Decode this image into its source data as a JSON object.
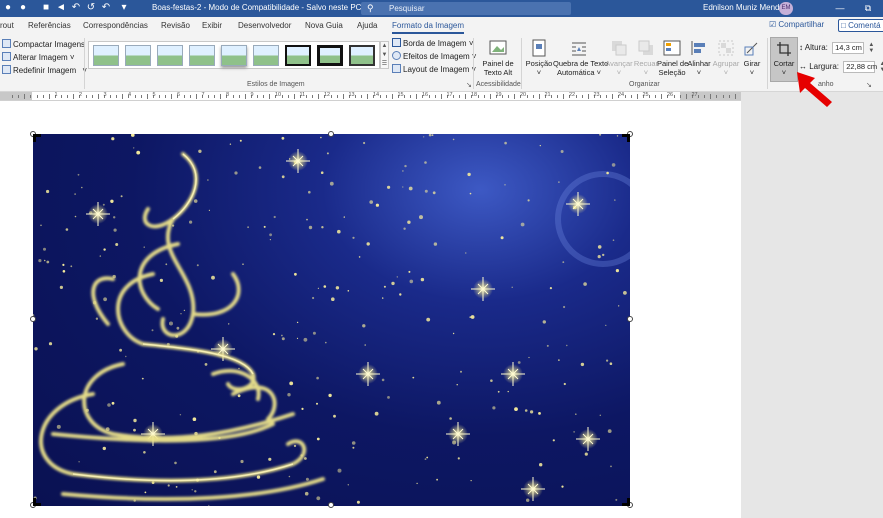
{
  "titlebar": {
    "doc_title": "Boas-festas-2  -  Modo de Compatibilidade  -  Salvo neste PC  ˅",
    "search_placeholder": "Pesquisar",
    "user_name": "Ednilson Muniz Mendes",
    "avatar_initials": "EM",
    "win_minimize": "—",
    "win_restore": "⧉"
  },
  "tabs": [
    "rout",
    "Referências",
    "Correspondências",
    "Revisão",
    "Exibir",
    "Desenvolvedor",
    "Nova Guia",
    "Ajuda",
    "Formato da Imagem"
  ],
  "share_label": "Compartilhar",
  "comments_label": "Comentá",
  "ribbon": {
    "adjust": {
      "compress": "Compactar Imagens",
      "change": "Alterar Imagem",
      "change_arrow": "˅",
      "reset": "Redefinir Imagem",
      "reset_arrow": "˅"
    },
    "styles": {
      "label": "Estilos de Imagem",
      "border": "Borda de Imagem ˅",
      "effects": "Efeitos de Imagem ˅",
      "layout": "Layout de Imagem ˅"
    },
    "accessibility": {
      "alt_text_line1": "Painel de",
      "alt_text_line2": "Texto Alt",
      "label": "Acessibilidade"
    },
    "organize": {
      "position": "Posição",
      "wrap_line1": "Quebra de Texto",
      "wrap_line2": "Automática ˅",
      "forward": "Avançar",
      "backward": "Recuar",
      "selection_line1": "Painel de",
      "selection_line2": "Seleção",
      "align": "Alinhar",
      "group": "Agrupar",
      "rotate": "Girar",
      "label": "Organizar"
    },
    "size": {
      "crop": "Cortar",
      "height_label": "Altura:",
      "height_value": "14,3 cm",
      "width_label": "Largura:",
      "width_value": "22,88 cm",
      "label": "anho"
    }
  },
  "ruler": {
    "numbers": [
      "1",
      "2",
      "3",
      "4",
      "5",
      "6",
      "7",
      "8",
      "9",
      "10",
      "11",
      "12",
      "13",
      "14",
      "15",
      "16",
      "17",
      "18",
      "19",
      "20",
      "21",
      "22",
      "23",
      "24",
      "25",
      "26",
      "27"
    ]
  },
  "colors": {
    "accent": "#2b579a",
    "swirl": "#f0e68c",
    "arrow": "#e60000"
  }
}
